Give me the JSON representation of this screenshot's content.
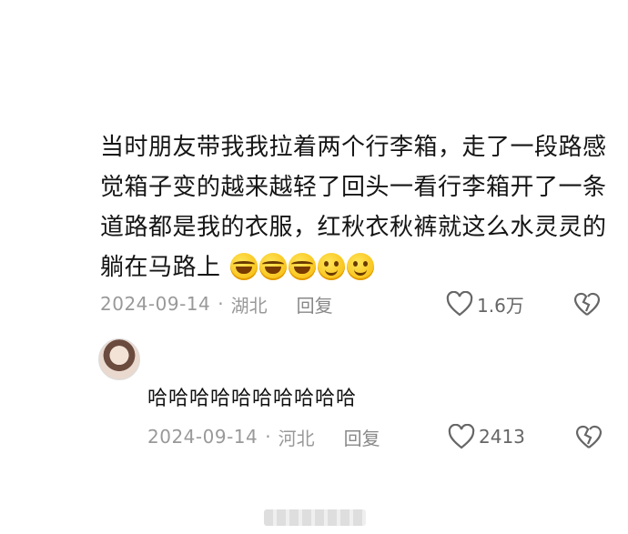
{
  "comment": {
    "text": "当时朋友带我我拉着两个行李箱，走了一段路感觉箱子变的越来越轻了回头一看行李箱开了一条道路都是我的衣服，红秋衣秋裤就这么水灵灵的躺在马路上",
    "emojis": [
      "laughing-crying-emoji",
      "laughing-crying-emoji",
      "laughing-crying-emoji",
      "smiling-emoji",
      "smiling-emoji"
    ],
    "date": "2024-09-14",
    "separator": "·",
    "location": "湖北",
    "reply_label": "回复",
    "likes": "1.6万"
  },
  "reply": {
    "text": "哈哈哈哈哈哈哈哈哈哈",
    "date": "2024-09-14",
    "separator": "·",
    "location": "河北",
    "reply_label": "回复",
    "likes": "2413"
  },
  "colors": {
    "meta_text": "#999999",
    "main_text": "#151515",
    "emoji_yellow": "#f6b400"
  }
}
